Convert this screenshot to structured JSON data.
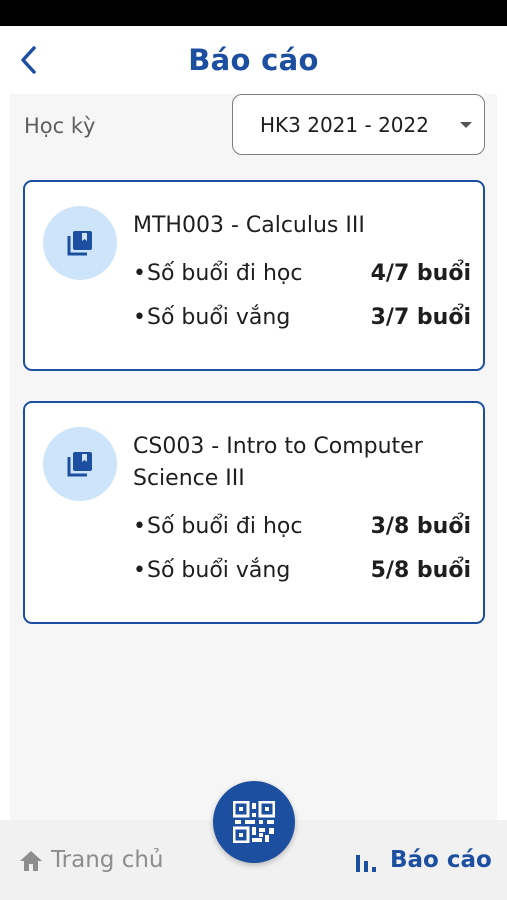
{
  "header": {
    "title": "Báo cáo",
    "back_icon": "chevron-left-icon"
  },
  "filter": {
    "label": "Học kỳ",
    "selected_semester": "HK3 2021 - 2022"
  },
  "courses": [
    {
      "name": "MTH003 - Calculus III",
      "icon": "library-books-icon",
      "attended_label": "Số buổi đi học",
      "attended_value": "4/7 buổi",
      "absent_label": "Số buổi vắng",
      "absent_value": "3/7 buổi"
    },
    {
      "name": "CS003 - Intro to Computer Science III",
      "icon": "library-books-icon",
      "attended_label": "Số buổi đi học",
      "attended_value": "3/8 buổi",
      "absent_label": "Số buổi vắng",
      "absent_value": "5/8 buổi"
    }
  ],
  "bullet": "•",
  "bottom_nav": {
    "home_label": "Trang chủ",
    "report_label": "Báo cáo",
    "qr_icon": "qr-code-icon"
  },
  "colors": {
    "primary": "#1c4fa0",
    "icon_bg": "#cde4fb",
    "content_bg": "#f6f6f6",
    "inactive": "#8d8d8d"
  }
}
